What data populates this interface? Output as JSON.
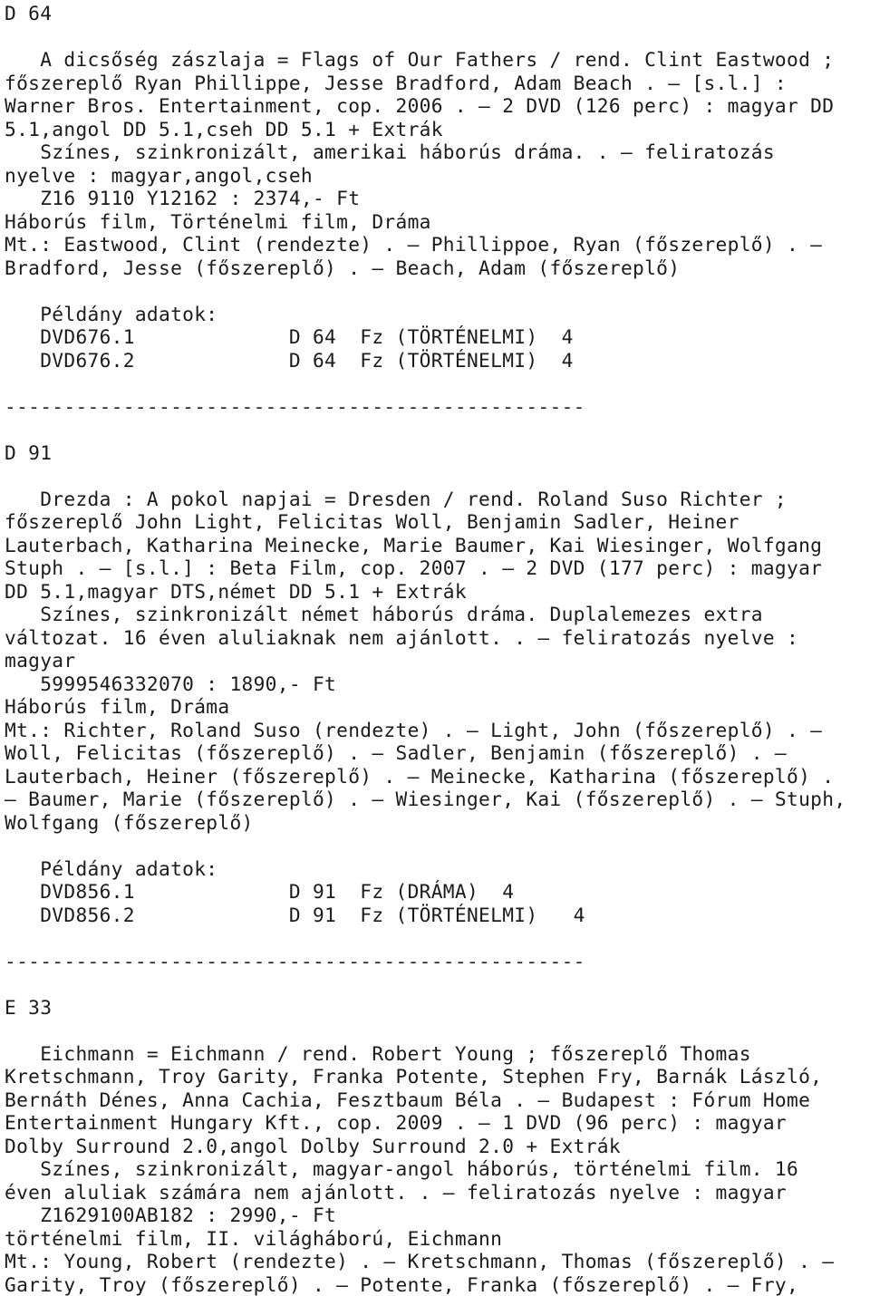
{
  "document": {
    "type": "library-catalog-listing",
    "language": "hu",
    "separator": "-------------------------------------------------",
    "records": [
      {
        "call_number": "D 64",
        "title_line_1": "   A dicsőség zászlaja = Flags of Our Fathers / rend. Clint Eastwood ;",
        "body_lines": [
          "főszereplő Ryan Phillippe, Jesse Bradford, Adam Beach . — [s.l.] :",
          "Warner Bros. Entertainment, cop. 2006 . — 2 DVD (126 perc) : magyar DD",
          "5.1,angol DD 5.1,cseh DD 5.1 + Extrák",
          "   Színes, szinkronizált, amerikai háborús dráma. . — feliratozás",
          "nyelve : magyar,angol,cseh",
          "   Z16 9110 Y12162 : 2374,- Ft",
          "Háborús film, Történelmi film, Dráma",
          "Mt.: Eastwood, Clint (rendezte) . — Phillippoe, Ryan (főszereplő) . —",
          "Bradford, Jesse (főszereplő) . — Beach, Adam (főszereplő)"
        ],
        "copies_header": "   Példány adatok:",
        "copies": [
          "   DVD676.1             D 64  Fz (TÖRTÉNELMI)  4",
          "   DVD676.2             D 64  Fz (TÖRTÉNELMI)  4"
        ]
      },
      {
        "call_number": "D 91",
        "title_line_1": "   Drezda : A pokol napjai = Dresden / rend. Roland Suso Richter ;",
        "body_lines": [
          "főszereplő John Light, Felicitas Woll, Benjamin Sadler, Heiner",
          "Lauterbach, Katharina Meinecke, Marie Baumer, Kai Wiesinger, Wolfgang",
          "Stuph . — [s.l.] : Beta Film, cop. 2007 . — 2 DVD (177 perc) : magyar",
          "DD 5.1,magyar DTS,német DD 5.1 + Extrák",
          "   Színes, szinkronizált német háborús dráma. Duplalemezes extra",
          "változat. 16 éven aluliaknak nem ajánlott. . — feliratozás nyelve :",
          "magyar",
          "   5999546332070 : 1890,- Ft",
          "Háborús film, Dráma",
          "Mt.: Richter, Roland Suso (rendezte) . — Light, John (főszereplő) . —",
          "Woll, Felicitas (főszereplő) . — Sadler, Benjamin (főszereplő) . —",
          "Lauterbach, Heiner (főszereplő) . — Meinecke, Katharina (főszereplő) .",
          "— Baumer, Marie (főszereplő) . — Wiesinger, Kai (főszereplő) . — Stuph,",
          "Wolfgang (főszereplő)"
        ],
        "copies_header": "   Példány adatok:",
        "copies": [
          "   DVD856.1             D 91  Fz (DRÁMA)  4",
          "   DVD856.2             D 91  Fz (TÖRTÉNELMI)   4"
        ]
      },
      {
        "call_number": "E 33",
        "title_line_1": "   Eichmann = Eichmann / rend. Robert Young ; főszereplő Thomas",
        "body_lines": [
          "Kretschmann, Troy Garity, Franka Potente, Stephen Fry, Barnák László,",
          "Bernáth Dénes, Anna Cachia, Fesztbaum Béla . — Budapest : Fórum Home",
          "Entertainment Hungary Kft., cop. 2009 . — 1 DVD (96 perc) : magyar",
          "Dolby Surround 2.0,angol Dolby Surround 2.0 + Extrák",
          "   Színes, szinkronizált, magyar-angol háborús, történelmi film. 16",
          "éven aluliak számára nem ajánlott. . — feliratozás nyelve : magyar",
          "   Z1629100AB182 : 2990,- Ft",
          "történelmi film, II. világháború, Eichmann",
          "Mt.: Young, Robert (rendezte) . — Kretschmann, Thomas (főszereplő) . —",
          "Garity, Troy (főszereplő) . — Potente, Franka (főszereplő) . — Fry,"
        ],
        "copies_header": "",
        "copies": []
      }
    ]
  },
  "lines": [
    "D 64",
    "",
    "   A dicsőség zászlaja = Flags of Our Fathers / rend. Clint Eastwood ;",
    "főszereplő Ryan Phillippe, Jesse Bradford, Adam Beach . — [s.l.] :",
    "Warner Bros. Entertainment, cop. 2006 . — 2 DVD (126 perc) : magyar DD",
    "5.1,angol DD 5.1,cseh DD 5.1 + Extrák",
    "   Színes, szinkronizált, amerikai háborús dráma. . — feliratozás",
    "nyelve : magyar,angol,cseh",
    "   Z16 9110 Y12162 : 2374,- Ft",
    "Háborús film, Történelmi film, Dráma",
    "Mt.: Eastwood, Clint (rendezte) . — Phillippoe, Ryan (főszereplő) . —",
    "Bradford, Jesse (főszereplő) . — Beach, Adam (főszereplő)",
    "",
    "   Példány adatok:",
    "   DVD676.1             D 64  Fz (TÖRTÉNELMI)  4",
    "   DVD676.2             D 64  Fz (TÖRTÉNELMI)  4",
    "",
    "-------------------------------------------------",
    "",
    "D 91",
    "",
    "   Drezda : A pokol napjai = Dresden / rend. Roland Suso Richter ;",
    "főszereplő John Light, Felicitas Woll, Benjamin Sadler, Heiner",
    "Lauterbach, Katharina Meinecke, Marie Baumer, Kai Wiesinger, Wolfgang",
    "Stuph . — [s.l.] : Beta Film, cop. 2007 . — 2 DVD (177 perc) : magyar",
    "DD 5.1,magyar DTS,német DD 5.1 + Extrák",
    "   Színes, szinkronizált német háborús dráma. Duplalemezes extra",
    "változat. 16 éven aluliaknak nem ajánlott. . — feliratozás nyelve :",
    "magyar",
    "   5999546332070 : 1890,- Ft",
    "Háborús film, Dráma",
    "Mt.: Richter, Roland Suso (rendezte) . — Light, John (főszereplő) . —",
    "Woll, Felicitas (főszereplő) . — Sadler, Benjamin (főszereplő) . —",
    "Lauterbach, Heiner (főszereplő) . — Meinecke, Katharina (főszereplő) .",
    "— Baumer, Marie (főszereplő) . — Wiesinger, Kai (főszereplő) . — Stuph,",
    "Wolfgang (főszereplő)",
    "",
    "   Példány adatok:",
    "   DVD856.1             D 91  Fz (DRÁMA)  4",
    "   DVD856.2             D 91  Fz (TÖRTÉNELMI)   4",
    "",
    "-------------------------------------------------",
    "",
    "E 33",
    "",
    "   Eichmann = Eichmann / rend. Robert Young ; főszereplő Thomas",
    "Kretschmann, Troy Garity, Franka Potente, Stephen Fry, Barnák László,",
    "Bernáth Dénes, Anna Cachia, Fesztbaum Béla . — Budapest : Fórum Home",
    "Entertainment Hungary Kft., cop. 2009 . — 1 DVD (96 perc) : magyar",
    "Dolby Surround 2.0,angol Dolby Surround 2.0 + Extrák",
    "   Színes, szinkronizált, magyar-angol háborús, történelmi film. 16",
    "éven aluliak számára nem ajánlott. . — feliratozás nyelve : magyar",
    "   Z1629100AB182 : 2990,- Ft",
    "történelmi film, II. világháború, Eichmann",
    "Mt.: Young, Robert (rendezte) . — Kretschmann, Thomas (főszereplő) . —",
    "Garity, Troy (főszereplő) . — Potente, Franka (főszereplő) . — Fry,"
  ]
}
